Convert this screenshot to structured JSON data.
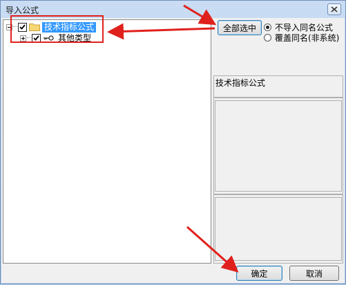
{
  "window": {
    "title": "导入公式",
    "close_icon": "close-icon"
  },
  "tree": {
    "root": {
      "label": "技术指标公式",
      "checked": true,
      "expanded": true,
      "icon": "folder-icon"
    },
    "child": {
      "label": "其他类型",
      "checked": true,
      "expanded": false,
      "icon": "key-icon"
    }
  },
  "options": {
    "select_all_label": "全部选中",
    "radio_options": [
      {
        "label": "不导入同名公式",
        "selected": true
      },
      {
        "label": "覆盖同名(非系统)",
        "selected": false
      }
    ]
  },
  "info": {
    "formula_category": "技术指标公式"
  },
  "footer": {
    "ok_label": "确定",
    "cancel_label": "取消"
  },
  "annotations": {
    "color": "#e0201c"
  }
}
